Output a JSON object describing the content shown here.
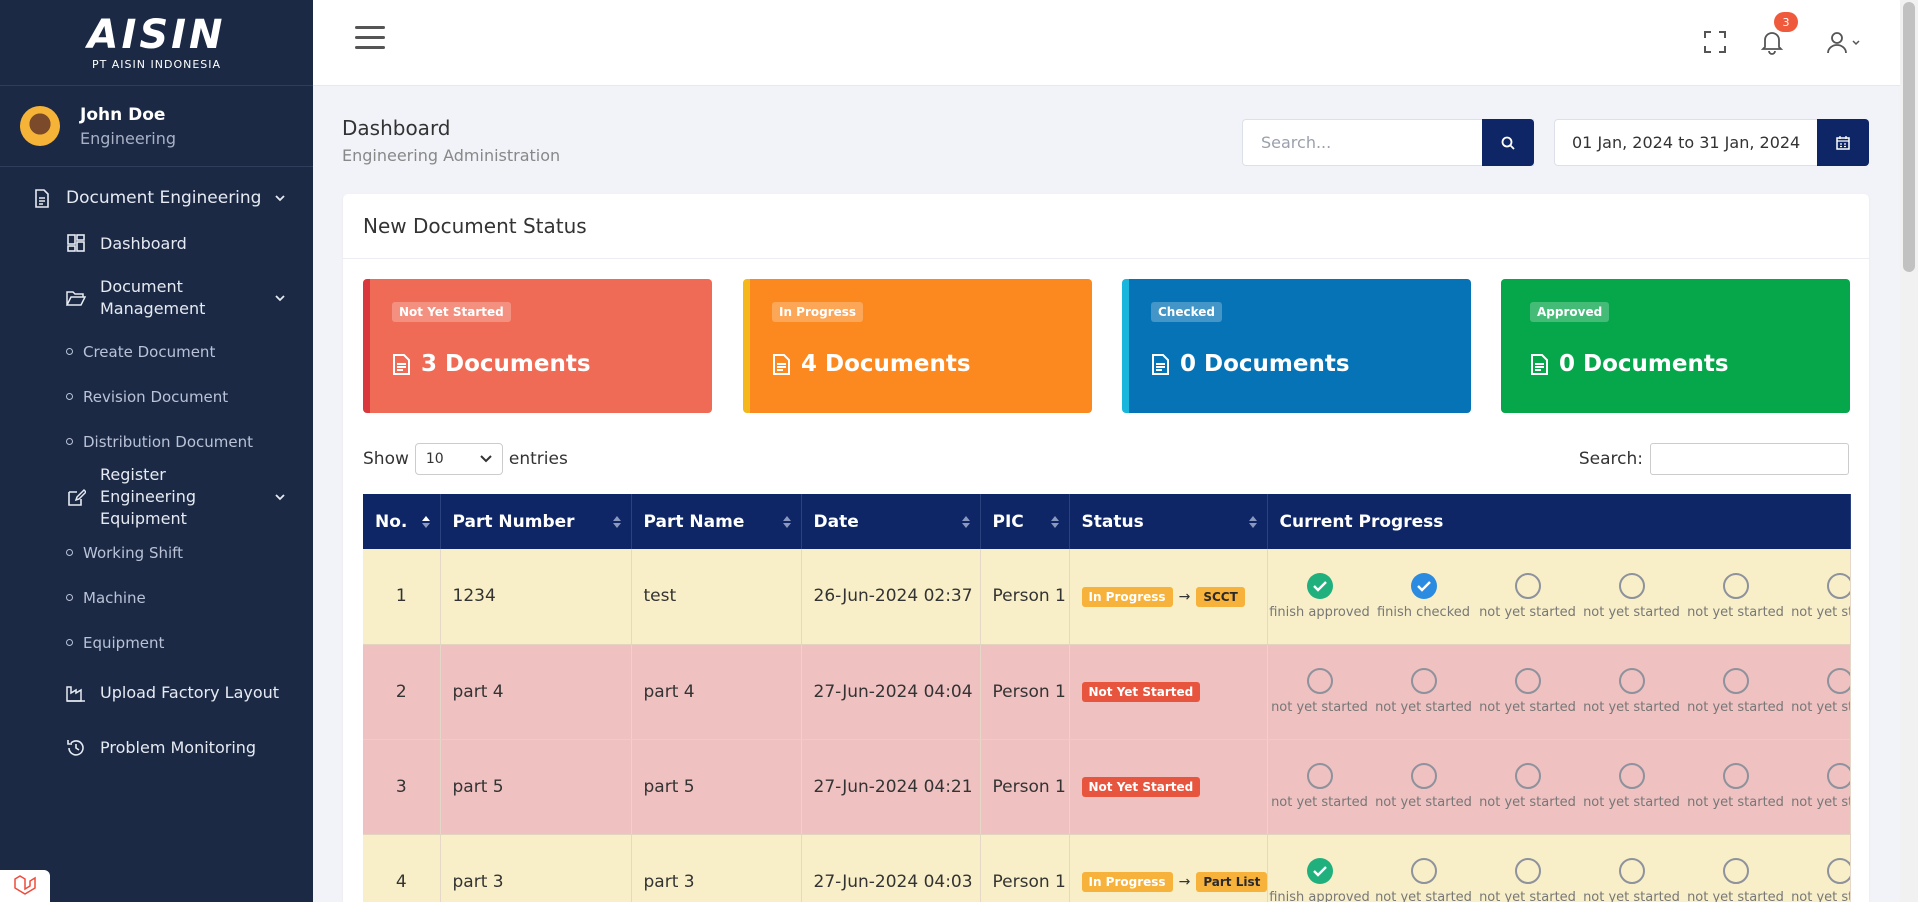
{
  "brand": {
    "logo": "AISIN",
    "subtitle": "PT AISIN INDONESIA"
  },
  "user": {
    "name": "John Doe",
    "role": "Engineering"
  },
  "nav": {
    "document_engineering": "Document Engineering",
    "dashboard": "Dashboard",
    "document_management": "Document Management",
    "create_document": "Create Document",
    "revision_document": "Revision Document",
    "distribution_document": "Distribution Document",
    "register_equipment": "Register Engineering Equipment",
    "working_shift": "Working Shift",
    "machine": "Machine",
    "equipment": "Equipment",
    "upload_layout": "Upload Factory Layout",
    "problem_monitoring": "Problem Monitoring"
  },
  "header": {
    "notification_count": "3"
  },
  "page": {
    "title": "Dashboard",
    "subtitle": "Engineering Administration"
  },
  "search": {
    "placeholder": "Search..."
  },
  "date_range": "01 Jan, 2024 to 31 Jan, 2024",
  "card_title": "New Document Status",
  "stats": [
    {
      "label": "Not Yet Started",
      "value": "3 Documents",
      "color": "#f06b55"
    },
    {
      "label": "In Progress",
      "value": "4 Documents",
      "color": "#fb891f"
    },
    {
      "label": "Checked",
      "value": "0 Documents",
      "color": "#0573b5"
    },
    {
      "label": "Approved",
      "value": "0 Documents",
      "color": "#06a64b"
    }
  ],
  "table_controls": {
    "show": "Show",
    "entries_value": "10",
    "entries": "entries",
    "search_label": "Search:"
  },
  "columns": [
    "No.",
    "Part Number",
    "Part Name",
    "Date",
    "PIC",
    "Status",
    "Current Progress"
  ],
  "rows": [
    {
      "no": "1",
      "part_number": "1234",
      "part_name": "test",
      "date": "26-Jun-2024 02:37",
      "pic": "Person 1",
      "status": "In Progress",
      "step": "SCCT",
      "progress": [
        "finish approved",
        "finish checked",
        "not yet started",
        "not yet started",
        "not yet started",
        "not yet started"
      ]
    },
    {
      "no": "2",
      "part_number": "part 4",
      "part_name": "part 4",
      "date": "27-Jun-2024 04:04",
      "pic": "Person 1",
      "status": "Not Yet Started",
      "step": "",
      "progress": [
        "not yet started",
        "not yet started",
        "not yet started",
        "not yet started",
        "not yet started",
        "not yet started"
      ]
    },
    {
      "no": "3",
      "part_number": "part 5",
      "part_name": "part 5",
      "date": "27-Jun-2024 04:21",
      "pic": "Person 1",
      "status": "Not Yet Started",
      "step": "",
      "progress": [
        "not yet started",
        "not yet started",
        "not yet started",
        "not yet started",
        "not yet started",
        "not yet started"
      ]
    },
    {
      "no": "4",
      "part_number": "part 3",
      "part_name": "part 3",
      "date": "27-Jun-2024 04:03",
      "pic": "Person 1",
      "status": "In Progress",
      "step": "Part List",
      "progress": [
        "finish approved",
        "not yet started",
        "not yet started",
        "not yet started",
        "not yet started",
        "not yet started"
      ]
    }
  ]
}
